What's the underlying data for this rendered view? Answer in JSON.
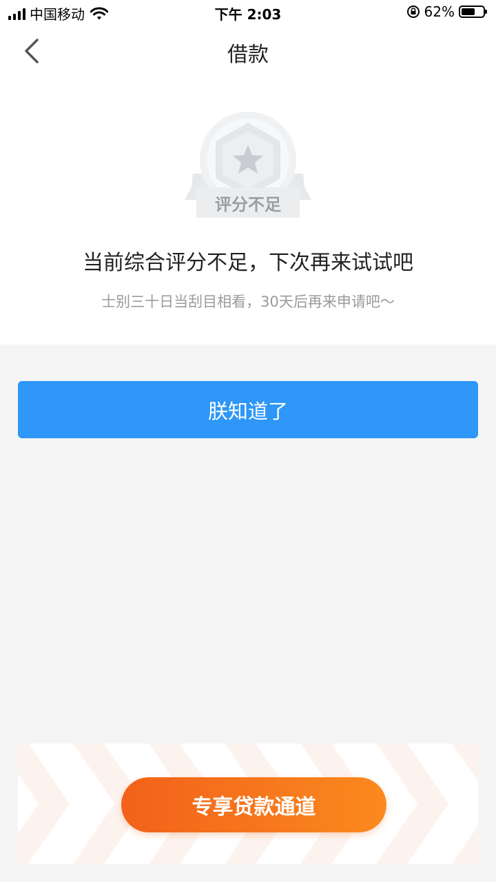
{
  "status_bar": {
    "carrier": "中国移动",
    "time": "下午 2:03",
    "battery_percent": "62%",
    "battery_level": 0.62
  },
  "nav": {
    "title": "借款"
  },
  "badge": {
    "label": "评分不足"
  },
  "message": {
    "main": "当前综合评分不足，下次再来试试吧",
    "sub": "士别三十日当刮目相看，30天后再来申请吧～"
  },
  "primary_button": {
    "label": "朕知道了"
  },
  "promo": {
    "button_label": "专享贷款通道"
  },
  "colors": {
    "primary": "#2e97f8",
    "promo_start": "#f2611a",
    "promo_end": "#fb8a1f",
    "page_bg": "#f5f5f5"
  },
  "icons": [
    "signal-icon",
    "wifi-icon",
    "rotation-lock-icon",
    "battery-icon",
    "back-chevron-icon",
    "star-badge-icon"
  ]
}
